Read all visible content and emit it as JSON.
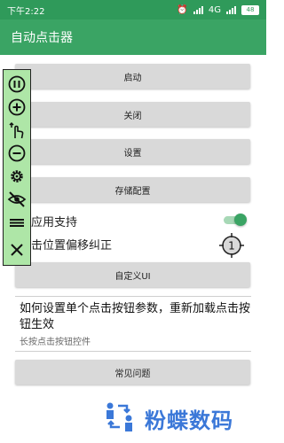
{
  "status_bar": {
    "time": "下午2:22",
    "network": "4G",
    "battery": "48"
  },
  "app_bar": {
    "title": "自动点击器"
  },
  "buttons": {
    "start": "启动",
    "close": "关闭",
    "settings": "设置",
    "save_config": "存储配置",
    "custom_ui": "自定义UI",
    "faq": "常见问题"
  },
  "options": {
    "cross_app": {
      "label": "跨应用支持",
      "enabled": true
    },
    "offset_correction": {
      "label": "点击位置偏移纠正",
      "target_number": "1"
    }
  },
  "help": {
    "title": "如何设置单个点击按钮参数，重新加载点击按钮生效",
    "subtitle": "长按点击按钮控件"
  },
  "floating_toolbar": {
    "background": "#aee6a7",
    "icons": [
      "pause-icon",
      "add-icon",
      "tap-gesture-icon",
      "remove-icon",
      "gear-icon",
      "eye-off-icon",
      "menu-icon",
      "close-icon"
    ]
  },
  "watermark": {
    "text": "粉蝶数码"
  },
  "colors": {
    "primary": "#3aa464",
    "status_bar": "#2f9a5a",
    "button_bg": "#d9d9d9"
  }
}
